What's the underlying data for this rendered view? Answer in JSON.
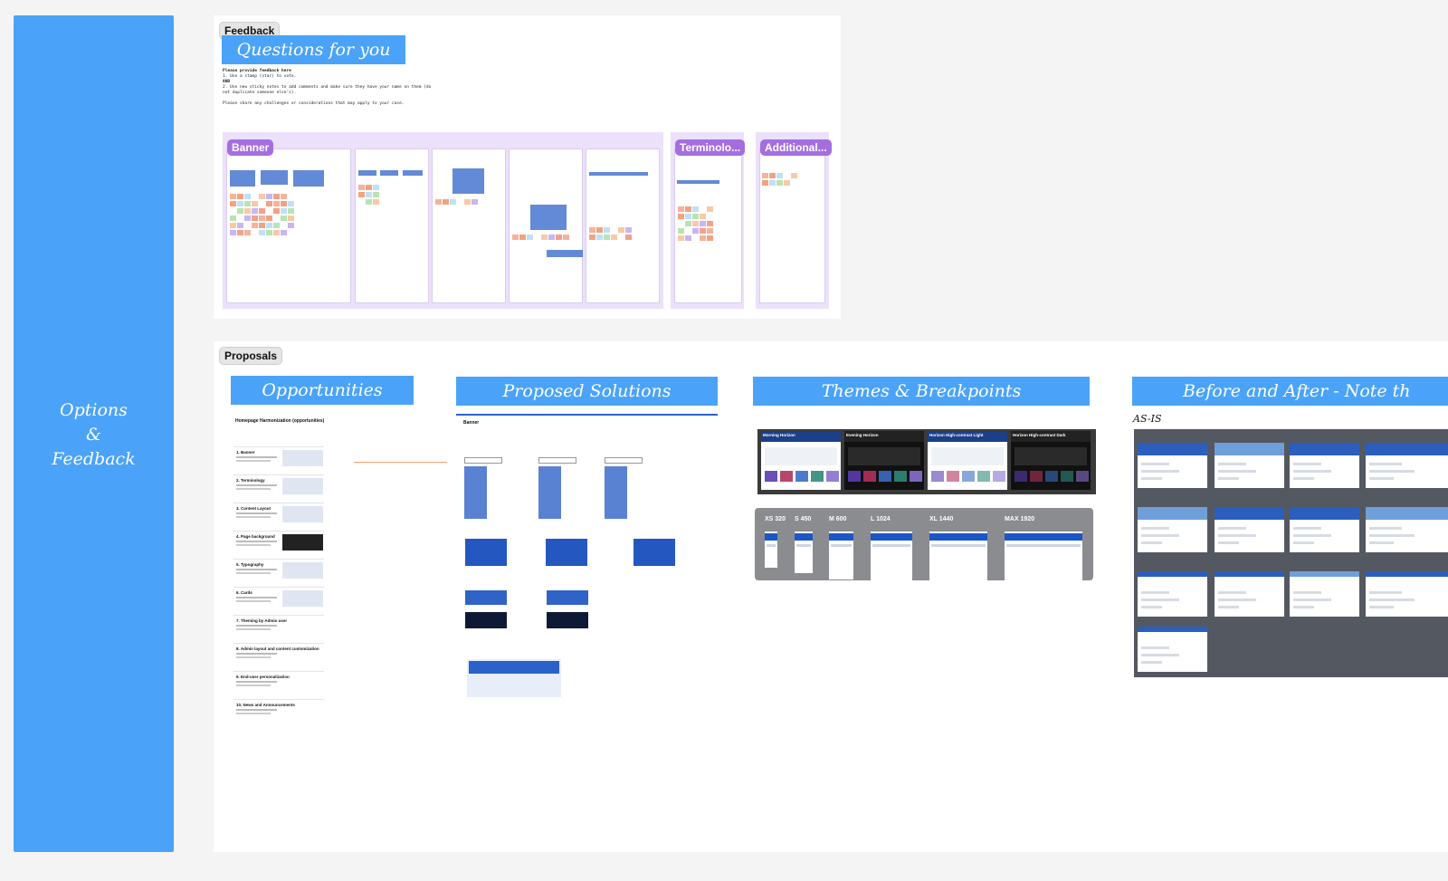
{
  "sidebar": {
    "label_line1": "Options",
    "label_line2": "&",
    "label_line3": "Feedback",
    "color": "#4aa3f8"
  },
  "feedback": {
    "tag": "Feedback",
    "heading": "Questions for you",
    "instructions": [
      "Please provide feedback here",
      "1. Use a stamp (star) to vote.",
      "   AND",
      "2. Use new sticky notes to add comments and make sure they have your name on them (do",
      "   not duplicate someone else's).",
      "",
      "Please share any challenges or considerations that may apply to your case."
    ],
    "columns": [
      {
        "tag": "Banner"
      },
      {
        "tag": "Terminolo..."
      },
      {
        "tag": "Additional..."
      }
    ],
    "accent_color": "#a56ee0"
  },
  "proposals": {
    "tag": "Proposals",
    "headers": {
      "opportunities": "Opportunities",
      "solutions": "Proposed Solutions",
      "themes": "Themes & Breakpoints",
      "before_after": "Before and After - Note th"
    },
    "opportunities_doc": {
      "title": "Homepage Harmonization (opportunities)",
      "items": [
        "1. Banner",
        "2. Terminology",
        "3. Content Layout",
        "4. Page background",
        "5. Typography",
        "6. Cards",
        "7. Theming by Admin user",
        "8. Admin layout and content customization",
        "9. End-user personalization",
        "10. News and Announcements"
      ]
    },
    "solutions_doc": {
      "title": "Banner"
    },
    "themes": [
      "Morning Horizon",
      "Evening Horizon",
      "Horizon High-contrast Light",
      "Horizon High-contrast Dark"
    ],
    "breakpoints": [
      "XS 320",
      "S 450",
      "M 600",
      "L 1024",
      "XL 1440",
      "MAX 1920"
    ],
    "asis_label": "AS-IS"
  }
}
